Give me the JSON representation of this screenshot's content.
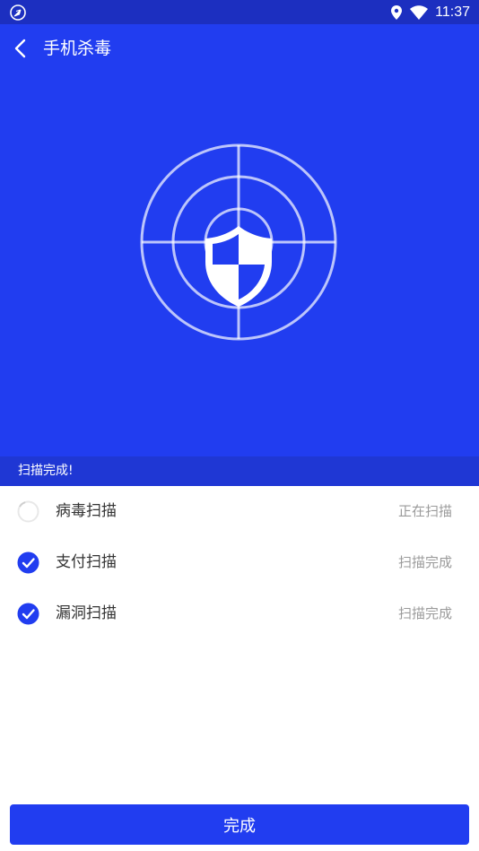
{
  "status_bar": {
    "time": "11:37"
  },
  "header": {
    "title": "手机杀毒"
  },
  "scan_status": {
    "text": "扫描完成!"
  },
  "scan_items": [
    {
      "label": "病毒扫描",
      "state": "正在扫描",
      "done": false
    },
    {
      "label": "支付扫描",
      "state": "扫描完成",
      "done": true
    },
    {
      "label": "漏洞扫描",
      "state": "扫描完成",
      "done": true
    }
  ],
  "footer": {
    "done_label": "完成"
  },
  "colors": {
    "primary": "#213df0",
    "status_bar": "#1c2fc0",
    "strip": "#1f37d4",
    "muted_text": "#9a9a9a"
  },
  "icons": [
    "navigation-icon",
    "location-icon",
    "wifi-icon",
    "back-icon",
    "shield-icon",
    "radar-icon",
    "check-icon",
    "spinner-icon"
  ]
}
